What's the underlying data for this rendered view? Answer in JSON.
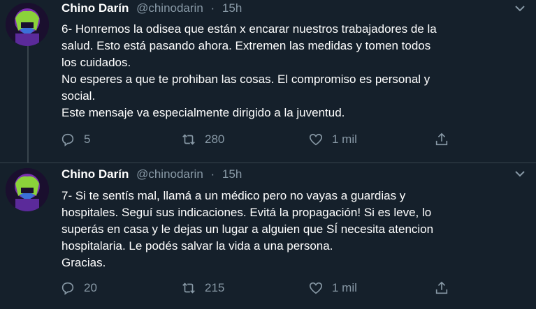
{
  "tweets": [
    {
      "display_name": "Chino Darín",
      "handle": "@chinodarin",
      "separator": "·",
      "time": "15h",
      "text": "6- Honremos la odisea que están x encarar nuestros trabajadores de la\nsalud. Esto está pasando ahora. Extremen las medidas y tomen todos\nlos cuidados.\nNo esperes a que te prohiban las cosas. El compromiso es personal y\nsocial.\nEste mensaje va especialmente dirigido a la juventud.",
      "replies": "5",
      "retweets": "280",
      "likes": "1 mil"
    },
    {
      "display_name": "Chino Darín",
      "handle": "@chinodarin",
      "separator": "·",
      "time": "15h",
      "text": "7- Si te sentís mal, llamá a un médico pero no vayas a guardias y\nhospitales. Seguí sus indicaciones. Evitá la propagación! Si es leve, lo\nsuperás en casa y le dejas un lugar a alguien que SÍ necesita atencion\nhospitalaria. Le podés salvar la vida a una persona.\nGracias.",
      "replies": "20",
      "retweets": "215",
      "likes": "1 mil"
    }
  ],
  "icons": {
    "reply": "reply-icon",
    "retweet": "retweet-icon",
    "like": "heart-icon",
    "share": "share-icon",
    "more": "chevron-down-icon"
  },
  "colors": {
    "background": "#15202b",
    "text_primary": "#ffffff",
    "text_secondary": "#8899a6",
    "divider": "#38444d"
  }
}
